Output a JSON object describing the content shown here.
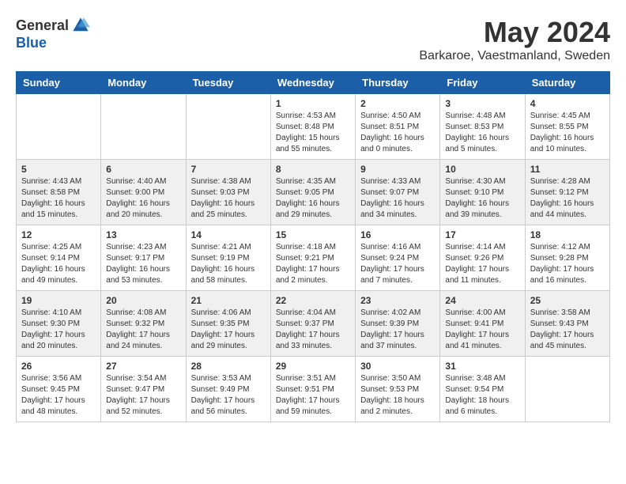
{
  "header": {
    "logo_general": "General",
    "logo_blue": "Blue",
    "month_year": "May 2024",
    "location": "Barkaroe, Vaestmanland, Sweden"
  },
  "weekdays": [
    "Sunday",
    "Monday",
    "Tuesday",
    "Wednesday",
    "Thursday",
    "Friday",
    "Saturday"
  ],
  "weeks": [
    [
      {
        "day": null,
        "info": null
      },
      {
        "day": null,
        "info": null
      },
      {
        "day": null,
        "info": null
      },
      {
        "day": "1",
        "info": "Sunrise: 4:53 AM\nSunset: 8:48 PM\nDaylight: 15 hours\nand 55 minutes."
      },
      {
        "day": "2",
        "info": "Sunrise: 4:50 AM\nSunset: 8:51 PM\nDaylight: 16 hours\nand 0 minutes."
      },
      {
        "day": "3",
        "info": "Sunrise: 4:48 AM\nSunset: 8:53 PM\nDaylight: 16 hours\nand 5 minutes."
      },
      {
        "day": "4",
        "info": "Sunrise: 4:45 AM\nSunset: 8:55 PM\nDaylight: 16 hours\nand 10 minutes."
      }
    ],
    [
      {
        "day": "5",
        "info": "Sunrise: 4:43 AM\nSunset: 8:58 PM\nDaylight: 16 hours\nand 15 minutes."
      },
      {
        "day": "6",
        "info": "Sunrise: 4:40 AM\nSunset: 9:00 PM\nDaylight: 16 hours\nand 20 minutes."
      },
      {
        "day": "7",
        "info": "Sunrise: 4:38 AM\nSunset: 9:03 PM\nDaylight: 16 hours\nand 25 minutes."
      },
      {
        "day": "8",
        "info": "Sunrise: 4:35 AM\nSunset: 9:05 PM\nDaylight: 16 hours\nand 29 minutes."
      },
      {
        "day": "9",
        "info": "Sunrise: 4:33 AM\nSunset: 9:07 PM\nDaylight: 16 hours\nand 34 minutes."
      },
      {
        "day": "10",
        "info": "Sunrise: 4:30 AM\nSunset: 9:10 PM\nDaylight: 16 hours\nand 39 minutes."
      },
      {
        "day": "11",
        "info": "Sunrise: 4:28 AM\nSunset: 9:12 PM\nDaylight: 16 hours\nand 44 minutes."
      }
    ],
    [
      {
        "day": "12",
        "info": "Sunrise: 4:25 AM\nSunset: 9:14 PM\nDaylight: 16 hours\nand 49 minutes."
      },
      {
        "day": "13",
        "info": "Sunrise: 4:23 AM\nSunset: 9:17 PM\nDaylight: 16 hours\nand 53 minutes."
      },
      {
        "day": "14",
        "info": "Sunrise: 4:21 AM\nSunset: 9:19 PM\nDaylight: 16 hours\nand 58 minutes."
      },
      {
        "day": "15",
        "info": "Sunrise: 4:18 AM\nSunset: 9:21 PM\nDaylight: 17 hours\nand 2 minutes."
      },
      {
        "day": "16",
        "info": "Sunrise: 4:16 AM\nSunset: 9:24 PM\nDaylight: 17 hours\nand 7 minutes."
      },
      {
        "day": "17",
        "info": "Sunrise: 4:14 AM\nSunset: 9:26 PM\nDaylight: 17 hours\nand 11 minutes."
      },
      {
        "day": "18",
        "info": "Sunrise: 4:12 AM\nSunset: 9:28 PM\nDaylight: 17 hours\nand 16 minutes."
      }
    ],
    [
      {
        "day": "19",
        "info": "Sunrise: 4:10 AM\nSunset: 9:30 PM\nDaylight: 17 hours\nand 20 minutes."
      },
      {
        "day": "20",
        "info": "Sunrise: 4:08 AM\nSunset: 9:32 PM\nDaylight: 17 hours\nand 24 minutes."
      },
      {
        "day": "21",
        "info": "Sunrise: 4:06 AM\nSunset: 9:35 PM\nDaylight: 17 hours\nand 29 minutes."
      },
      {
        "day": "22",
        "info": "Sunrise: 4:04 AM\nSunset: 9:37 PM\nDaylight: 17 hours\nand 33 minutes."
      },
      {
        "day": "23",
        "info": "Sunrise: 4:02 AM\nSunset: 9:39 PM\nDaylight: 17 hours\nand 37 minutes."
      },
      {
        "day": "24",
        "info": "Sunrise: 4:00 AM\nSunset: 9:41 PM\nDaylight: 17 hours\nand 41 minutes."
      },
      {
        "day": "25",
        "info": "Sunrise: 3:58 AM\nSunset: 9:43 PM\nDaylight: 17 hours\nand 45 minutes."
      }
    ],
    [
      {
        "day": "26",
        "info": "Sunrise: 3:56 AM\nSunset: 9:45 PM\nDaylight: 17 hours\nand 48 minutes."
      },
      {
        "day": "27",
        "info": "Sunrise: 3:54 AM\nSunset: 9:47 PM\nDaylight: 17 hours\nand 52 minutes."
      },
      {
        "day": "28",
        "info": "Sunrise: 3:53 AM\nSunset: 9:49 PM\nDaylight: 17 hours\nand 56 minutes."
      },
      {
        "day": "29",
        "info": "Sunrise: 3:51 AM\nSunset: 9:51 PM\nDaylight: 17 hours\nand 59 minutes."
      },
      {
        "day": "30",
        "info": "Sunrise: 3:50 AM\nSunset: 9:53 PM\nDaylight: 18 hours\nand 2 minutes."
      },
      {
        "day": "31",
        "info": "Sunrise: 3:48 AM\nSunset: 9:54 PM\nDaylight: 18 hours\nand 6 minutes."
      },
      {
        "day": null,
        "info": null
      }
    ]
  ]
}
